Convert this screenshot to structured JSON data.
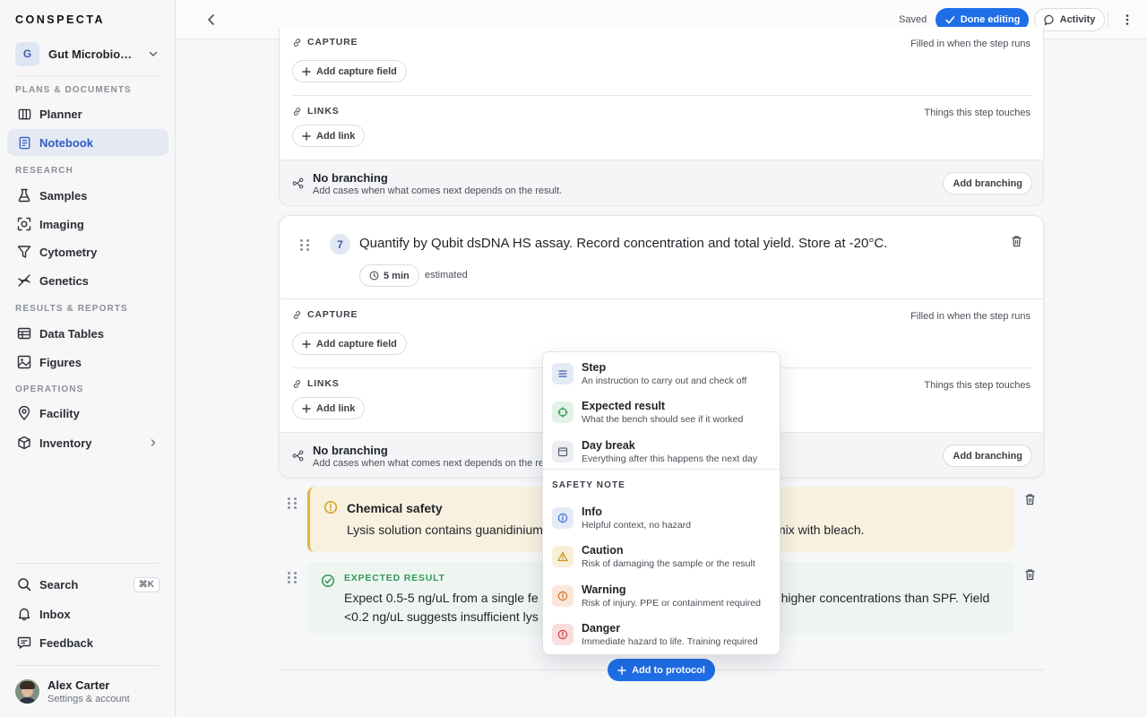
{
  "sidebar": {
    "brand": "CONSPECTA",
    "workspace": {
      "initial": "G",
      "name": "Gut Microbiome Study"
    },
    "sections": {
      "plans": "PLANS & DOCUMENTS",
      "research": "RESEARCH",
      "results": "RESULTS & REPORTS",
      "operations": "OPERATIONS"
    },
    "items": {
      "planner": "Planner",
      "notebook": "Notebook",
      "samples": "Samples",
      "imaging": "Imaging",
      "cytometry": "Cytometry",
      "genetics": "Genetics",
      "data_tables": "Data Tables",
      "figures": "Figures",
      "facility": "Facility",
      "inventory": "Inventory",
      "search": "Search",
      "inbox": "Inbox",
      "feedback": "Feedback"
    },
    "search_shortcut": "⌘K",
    "active": "notebook",
    "user": {
      "name": "Alex Carter",
      "subtitle": "Settings & account"
    }
  },
  "topbar": {
    "saved": "Saved",
    "done_editing": "Done editing",
    "activity": "Activity"
  },
  "step6": {
    "capture_label": "CAPTURE",
    "capture_hint": "Filled in when the step runs",
    "add_capture": "Add capture field",
    "links_label": "LINKS",
    "links_hint": "Things this step touches",
    "add_link": "Add link",
    "branch_title": "No branching",
    "branch_sub": "Add cases when what comes next depends on the result.",
    "add_branching": "Add branching"
  },
  "step7": {
    "number": "7",
    "text": "Quantify by Qubit dsDNA HS assay. Record concentration and total yield. Store at -20°C.",
    "duration": "5 min",
    "estimated": "estimated",
    "capture_label": "CAPTURE",
    "capture_hint": "Filled in when the step runs",
    "add_capture": "Add capture field",
    "links_label": "LINKS",
    "links_hint": "Things this step touches",
    "add_link": "Add link",
    "branch_title": "No branching",
    "branch_sub": "Add cases when what comes next depends on the result.",
    "add_branching": "Add branching"
  },
  "safety_callout": {
    "title": "Chemical safety",
    "text_start": "Lysis solution contains guanidinium",
    "text_end": "mix with bleach."
  },
  "expected_callout": {
    "label": "EXPECTED RESULT",
    "text_start": "Expect 0.5-5 ng/uL from a single fe",
    "text_end": "l higher concentrations than SPF. Yield",
    "line2": "<0.2 ng/uL suggests insufficient lys"
  },
  "add_to_protocol": "Add to protocol",
  "menu": {
    "items": [
      {
        "title": "Step",
        "subtitle": "An instruction to carry out and check off",
        "icon": "list-icon",
        "color": "#3b5ea8",
        "bg": "#e4eaf6"
      },
      {
        "title": "Expected result",
        "subtitle": "What the bench should see if it worked",
        "icon": "target-icon",
        "color": "#2f9a5a",
        "bg": "#e2f2e8"
      },
      {
        "title": "Day break",
        "subtitle": "Everything after this happens the next day",
        "icon": "calendar-icon",
        "color": "#5b6270",
        "bg": "#eceef1"
      }
    ],
    "safety_section": "SAFETY NOTE",
    "safety": [
      {
        "title": "Info",
        "subtitle": "Helpful context, no hazard",
        "icon": "info-icon",
        "color": "#3b6ed4",
        "bg": "#e3ebf8"
      },
      {
        "title": "Caution",
        "subtitle": "Risk of damaging the sample or the result",
        "icon": "caution-icon",
        "color": "#c9961c",
        "bg": "#f8efd8"
      },
      {
        "title": "Warning",
        "subtitle": "Risk of injury. PPE or containment required",
        "icon": "warning-icon",
        "color": "#d9702a",
        "bg": "#fbe6d8"
      },
      {
        "title": "Danger",
        "subtitle": "Immediate hazard to life. Training required",
        "icon": "danger-icon",
        "color": "#d23d3d",
        "bg": "#fadede"
      }
    ]
  }
}
